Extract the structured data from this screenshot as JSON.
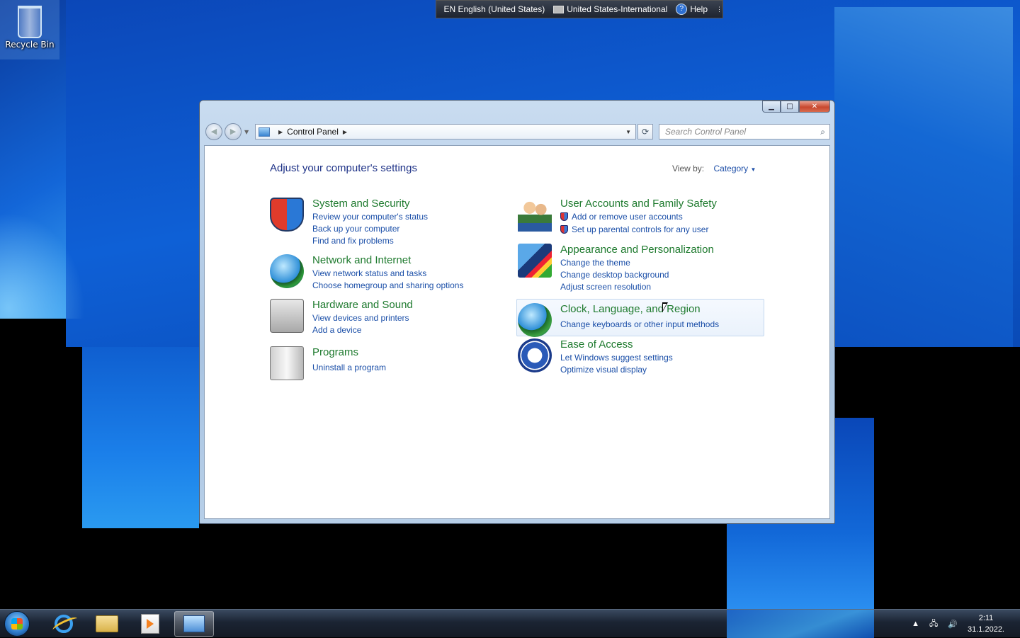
{
  "desktop": {
    "recycle_bin_label": "Recycle Bin"
  },
  "language_bar": {
    "language": "EN English (United States)",
    "keyboard": "United States-International",
    "help": "Help"
  },
  "window": {
    "breadcrumb": "Control Panel",
    "search_placeholder": "Search Control Panel",
    "heading": "Adjust your computer's settings",
    "view_by_label": "View by:",
    "view_by_value": "Category",
    "categories_left": [
      {
        "title": "System and Security",
        "links": [
          "Review your computer's status",
          "Back up your computer",
          "Find and fix problems"
        ]
      },
      {
        "title": "Network and Internet",
        "links": [
          "View network status and tasks",
          "Choose homegroup and sharing options"
        ]
      },
      {
        "title": "Hardware and Sound",
        "links": [
          "View devices and printers",
          "Add a device"
        ]
      },
      {
        "title": "Programs",
        "links": [
          "Uninstall a program"
        ]
      }
    ],
    "categories_right": [
      {
        "title": "User Accounts and Family Safety",
        "links": [
          "Add or remove user accounts",
          "Set up parental controls for any user"
        ]
      },
      {
        "title": "Appearance and Personalization",
        "links": [
          "Change the theme",
          "Change desktop background",
          "Adjust screen resolution"
        ]
      },
      {
        "title": "Clock, Language, and Region",
        "links": [
          "Change keyboards or other input methods"
        ]
      },
      {
        "title": "Ease of Access",
        "links": [
          "Let Windows suggest settings",
          "Optimize visual display"
        ]
      }
    ]
  },
  "taskbar": {
    "time": "2:11",
    "date": "31.1.2022."
  }
}
